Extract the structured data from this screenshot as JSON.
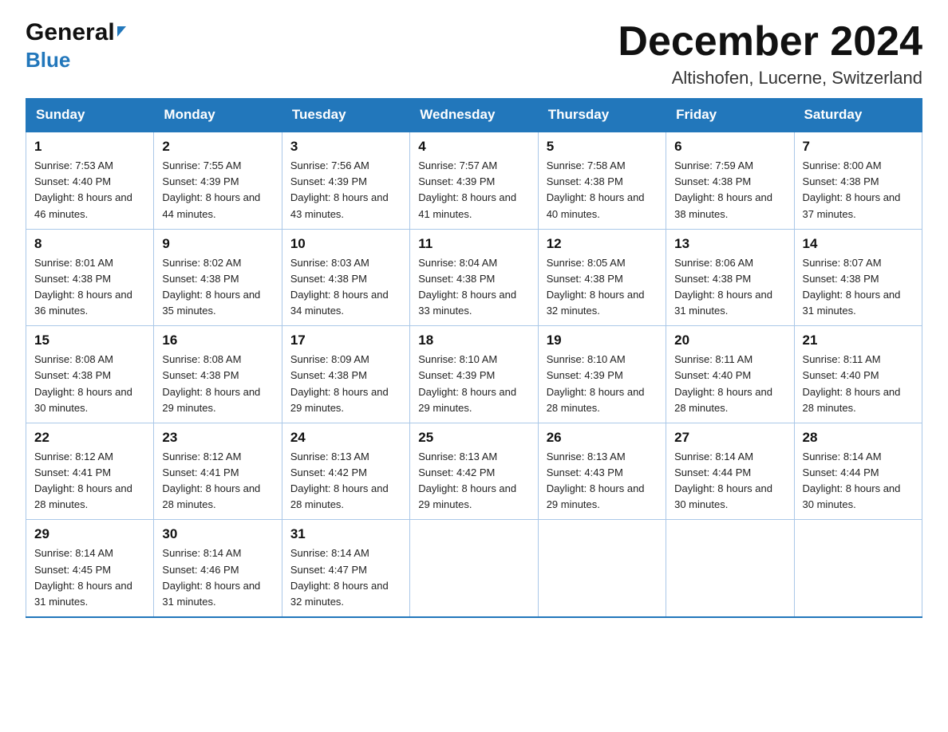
{
  "header": {
    "logo_general": "General",
    "logo_blue": "Blue",
    "month_title": "December 2024",
    "location": "Altishofen, Lucerne, Switzerland"
  },
  "weekdays": [
    "Sunday",
    "Monday",
    "Tuesday",
    "Wednesday",
    "Thursday",
    "Friday",
    "Saturday"
  ],
  "weeks": [
    [
      {
        "day": "1",
        "sunrise": "7:53 AM",
        "sunset": "4:40 PM",
        "daylight": "8 hours and 46 minutes."
      },
      {
        "day": "2",
        "sunrise": "7:55 AM",
        "sunset": "4:39 PM",
        "daylight": "8 hours and 44 minutes."
      },
      {
        "day": "3",
        "sunrise": "7:56 AM",
        "sunset": "4:39 PM",
        "daylight": "8 hours and 43 minutes."
      },
      {
        "day": "4",
        "sunrise": "7:57 AM",
        "sunset": "4:39 PM",
        "daylight": "8 hours and 41 minutes."
      },
      {
        "day": "5",
        "sunrise": "7:58 AM",
        "sunset": "4:38 PM",
        "daylight": "8 hours and 40 minutes."
      },
      {
        "day": "6",
        "sunrise": "7:59 AM",
        "sunset": "4:38 PM",
        "daylight": "8 hours and 38 minutes."
      },
      {
        "day": "7",
        "sunrise": "8:00 AM",
        "sunset": "4:38 PM",
        "daylight": "8 hours and 37 minutes."
      }
    ],
    [
      {
        "day": "8",
        "sunrise": "8:01 AM",
        "sunset": "4:38 PM",
        "daylight": "8 hours and 36 minutes."
      },
      {
        "day": "9",
        "sunrise": "8:02 AM",
        "sunset": "4:38 PM",
        "daylight": "8 hours and 35 minutes."
      },
      {
        "day": "10",
        "sunrise": "8:03 AM",
        "sunset": "4:38 PM",
        "daylight": "8 hours and 34 minutes."
      },
      {
        "day": "11",
        "sunrise": "8:04 AM",
        "sunset": "4:38 PM",
        "daylight": "8 hours and 33 minutes."
      },
      {
        "day": "12",
        "sunrise": "8:05 AM",
        "sunset": "4:38 PM",
        "daylight": "8 hours and 32 minutes."
      },
      {
        "day": "13",
        "sunrise": "8:06 AM",
        "sunset": "4:38 PM",
        "daylight": "8 hours and 31 minutes."
      },
      {
        "day": "14",
        "sunrise": "8:07 AM",
        "sunset": "4:38 PM",
        "daylight": "8 hours and 31 minutes."
      }
    ],
    [
      {
        "day": "15",
        "sunrise": "8:08 AM",
        "sunset": "4:38 PM",
        "daylight": "8 hours and 30 minutes."
      },
      {
        "day": "16",
        "sunrise": "8:08 AM",
        "sunset": "4:38 PM",
        "daylight": "8 hours and 29 minutes."
      },
      {
        "day": "17",
        "sunrise": "8:09 AM",
        "sunset": "4:38 PM",
        "daylight": "8 hours and 29 minutes."
      },
      {
        "day": "18",
        "sunrise": "8:10 AM",
        "sunset": "4:39 PM",
        "daylight": "8 hours and 29 minutes."
      },
      {
        "day": "19",
        "sunrise": "8:10 AM",
        "sunset": "4:39 PM",
        "daylight": "8 hours and 28 minutes."
      },
      {
        "day": "20",
        "sunrise": "8:11 AM",
        "sunset": "4:40 PM",
        "daylight": "8 hours and 28 minutes."
      },
      {
        "day": "21",
        "sunrise": "8:11 AM",
        "sunset": "4:40 PM",
        "daylight": "8 hours and 28 minutes."
      }
    ],
    [
      {
        "day": "22",
        "sunrise": "8:12 AM",
        "sunset": "4:41 PM",
        "daylight": "8 hours and 28 minutes."
      },
      {
        "day": "23",
        "sunrise": "8:12 AM",
        "sunset": "4:41 PM",
        "daylight": "8 hours and 28 minutes."
      },
      {
        "day": "24",
        "sunrise": "8:13 AM",
        "sunset": "4:42 PM",
        "daylight": "8 hours and 28 minutes."
      },
      {
        "day": "25",
        "sunrise": "8:13 AM",
        "sunset": "4:42 PM",
        "daylight": "8 hours and 29 minutes."
      },
      {
        "day": "26",
        "sunrise": "8:13 AM",
        "sunset": "4:43 PM",
        "daylight": "8 hours and 29 minutes."
      },
      {
        "day": "27",
        "sunrise": "8:14 AM",
        "sunset": "4:44 PM",
        "daylight": "8 hours and 30 minutes."
      },
      {
        "day": "28",
        "sunrise": "8:14 AM",
        "sunset": "4:44 PM",
        "daylight": "8 hours and 30 minutes."
      }
    ],
    [
      {
        "day": "29",
        "sunrise": "8:14 AM",
        "sunset": "4:45 PM",
        "daylight": "8 hours and 31 minutes."
      },
      {
        "day": "30",
        "sunrise": "8:14 AM",
        "sunset": "4:46 PM",
        "daylight": "8 hours and 31 minutes."
      },
      {
        "day": "31",
        "sunrise": "8:14 AM",
        "sunset": "4:47 PM",
        "daylight": "8 hours and 32 minutes."
      },
      null,
      null,
      null,
      null
    ]
  ],
  "labels": {
    "sunrise_prefix": "Sunrise: ",
    "sunset_prefix": "Sunset: ",
    "daylight_prefix": "Daylight: "
  }
}
